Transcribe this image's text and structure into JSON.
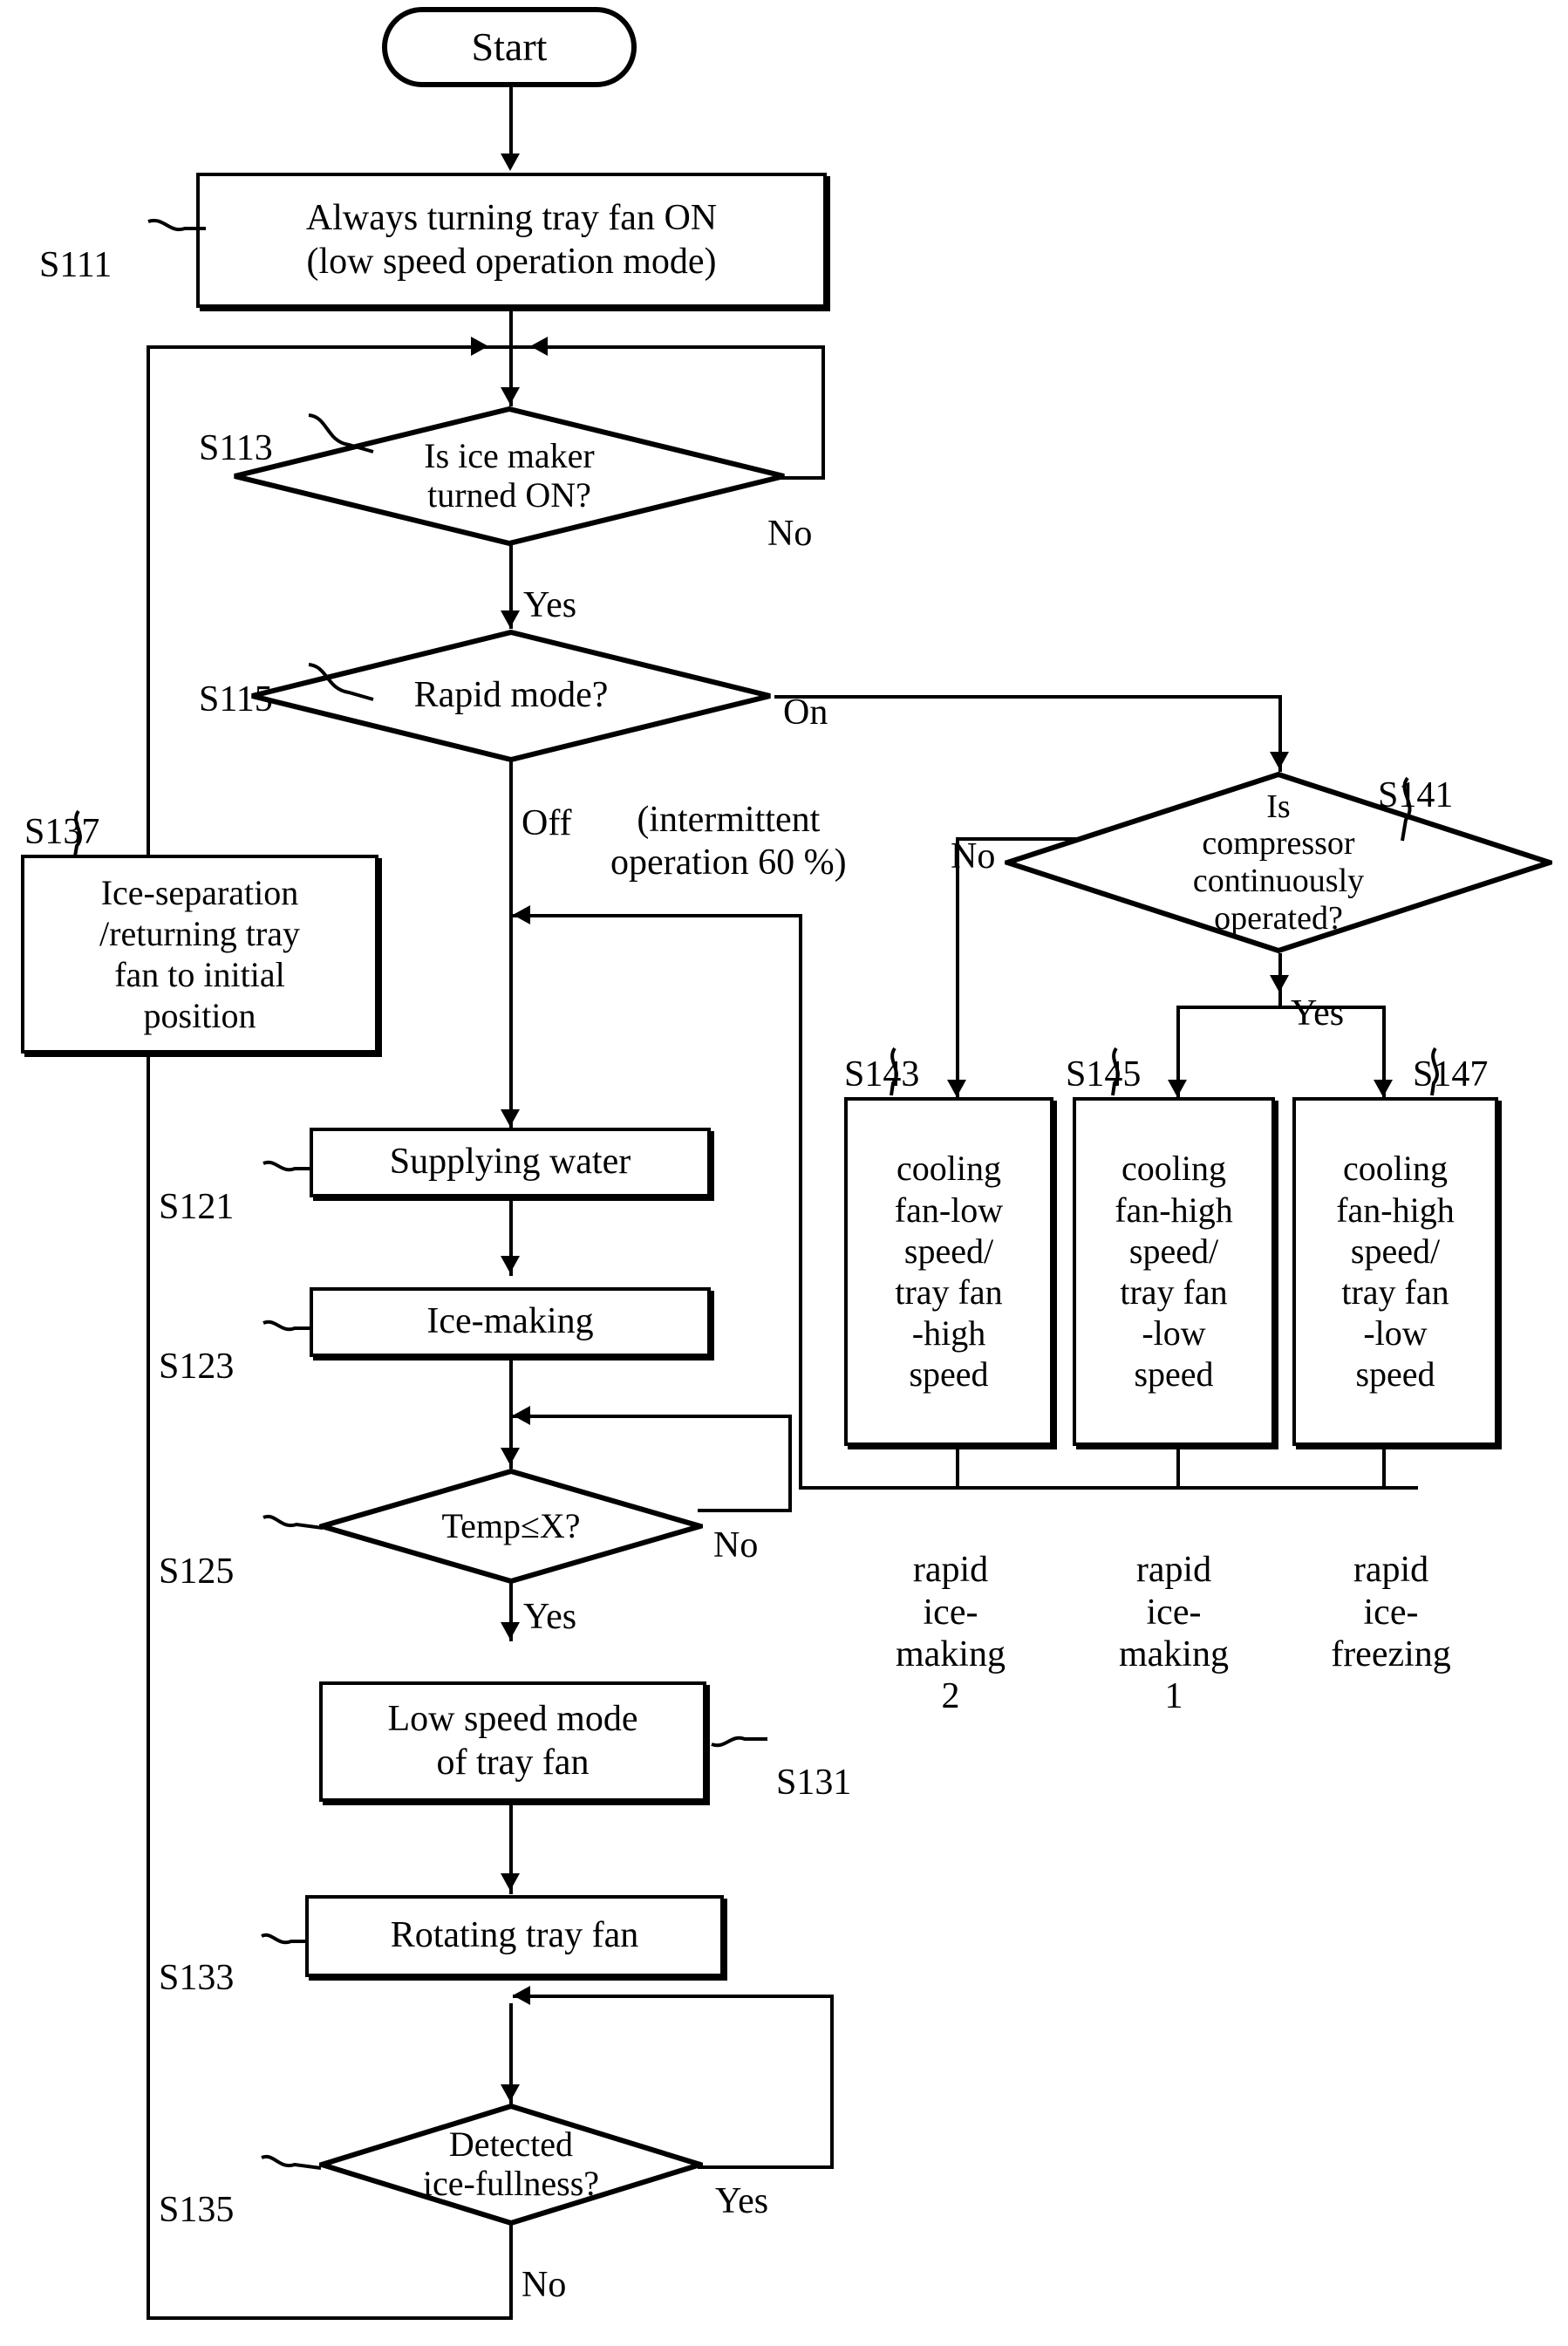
{
  "diagram": {
    "title": "Ice maker tray fan control flowchart",
    "type": "flowchart"
  },
  "nodes": {
    "start": {
      "label": "Start",
      "shape": "terminator"
    },
    "s111": {
      "step": "S111",
      "label": "Always turning tray fan ON\n(low speed operation mode)",
      "shape": "process"
    },
    "s113": {
      "step": "S113",
      "label": "Is ice maker\nturned ON?",
      "shape": "decision"
    },
    "s115": {
      "step": "S115",
      "label": "Rapid mode?",
      "shape": "decision"
    },
    "s137": {
      "step": "S137",
      "label": "Ice-separation\n/returning tray\nfan to initial\nposition",
      "shape": "process"
    },
    "s121": {
      "step": "S121",
      "label": "Supplying water",
      "shape": "process"
    },
    "s123": {
      "step": "S123",
      "label": "Ice-making",
      "shape": "process"
    },
    "s125": {
      "step": "S125",
      "label": "Temp≤X?",
      "shape": "decision"
    },
    "s131": {
      "step": "S131",
      "label": "Low speed mode\nof tray fan",
      "shape": "process"
    },
    "s133": {
      "step": "S133",
      "label": "Rotating tray fan",
      "shape": "process"
    },
    "s135": {
      "step": "S135",
      "label": "Detected\nice-fullness?",
      "shape": "decision"
    },
    "s141": {
      "step": "S141",
      "label": "Is\ncompressor\ncontinuously\noperated?",
      "shape": "decision"
    },
    "s143": {
      "step": "S143",
      "label": "cooling\nfan-low\nspeed/\ntray fan\n-high\nspeed",
      "shape": "process"
    },
    "s145": {
      "step": "S145",
      "label": "cooling\nfan-high\nspeed/\ntray fan\n-low\nspeed",
      "shape": "process"
    },
    "s147": {
      "step": "S147",
      "label": "cooling\nfan-high\nspeed/\ntray fan\n-low\nspeed",
      "shape": "process"
    }
  },
  "edge_labels": {
    "s113_no": "No",
    "s113_yes": "Yes",
    "s115_on": "On",
    "s115_off": "Off",
    "s115_note": "(intermittent\noperation 60 %)",
    "s141_no": "No",
    "s141_yes": "Yes",
    "s125_no": "No",
    "s125_yes": "Yes",
    "s135_yes": "Yes",
    "s135_no": "No"
  },
  "outcome_labels": {
    "s143_out": "rapid\nice-\nmaking\n2",
    "s145_out": "rapid\nice-\nmaking\n1",
    "s147_out": "rapid\nice-\nfreezing"
  },
  "colors": {
    "ink": "#000000",
    "paper": "#ffffff"
  }
}
